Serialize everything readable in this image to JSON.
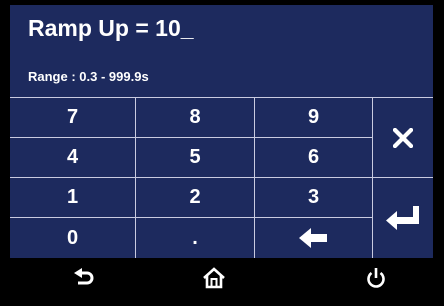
{
  "header": {
    "entry_text": "Ramp Up = 10_",
    "range_text": "Range : 0.3 - 999.9s"
  },
  "keypad": {
    "rows": [
      [
        "7",
        "8",
        "9"
      ],
      [
        "4",
        "5",
        "6"
      ],
      [
        "1",
        "2",
        "3"
      ],
      [
        "0",
        ".",
        ""
      ]
    ]
  },
  "icons": {
    "backspace": "left-arrow-icon",
    "clear": "close-icon",
    "enter": "enter-icon",
    "back": "back-arrow-icon",
    "home": "home-icon",
    "power": "power-icon"
  },
  "colors": {
    "panel": "#1d2a5e",
    "divider": "#c9cbe0",
    "background": "#000000",
    "text": "#ffffff"
  }
}
